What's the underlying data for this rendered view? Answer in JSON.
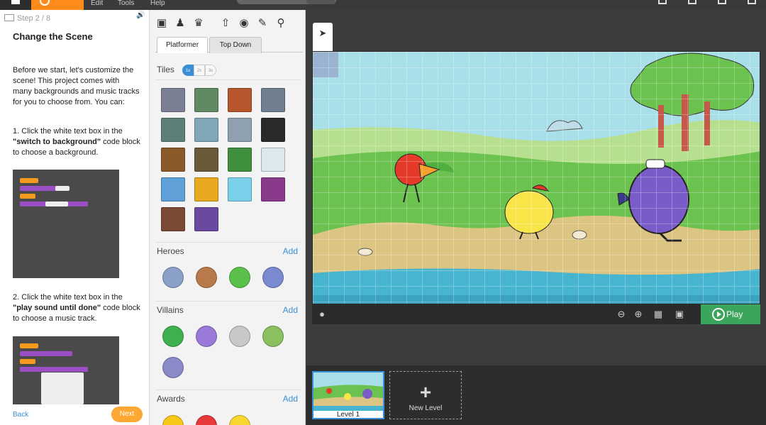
{
  "menu": {
    "edit": "Edit",
    "tools": "Tools",
    "help": "Help"
  },
  "instructions": {
    "step": "Step 2 / 8",
    "title": "Change the Scene",
    "intro": "Before we start, let's customize the scene! This project comes with many backgrounds and music tracks for you to choose from. You can:",
    "step1_pre": "1. Click the white text box in the ",
    "step1_bold": "\"switch to background\"",
    "step1_post": " code block to choose a background.",
    "step2_pre": "2. Click the white text box in the ",
    "step2_bold": "\"play sound until done\"",
    "step2_post": " code block to choose a music track.",
    "back": "Back",
    "next": "Next"
  },
  "assets": {
    "tabs": [
      "Platformer",
      "Top Down"
    ],
    "tiles_label": "Tiles",
    "size_options": [
      "1x",
      "2x",
      "3x"
    ],
    "heroes_label": "Heroes",
    "villains_label": "Villains",
    "awards_label": "Awards",
    "add": "Add",
    "tile_colors": [
      "#7b7f93",
      "#5f8a64",
      "#b7562c",
      "#6f7f8f",
      "#5d7f7a",
      "#7fa7b7",
      "#8fa0b0",
      "#2a2a2a",
      "#8a5a2a",
      "#6a5a3a",
      "#3f8f3f",
      "#dde8ef",
      "#5fa0d8",
      "#e8a820",
      "#7ad0e8",
      "#8a3a8a",
      "#7a4a34",
      "#6a4aa0"
    ],
    "hero_colors": [
      "#8aa0c8",
      "#b87a4a",
      "#5ac04a",
      "#7a8ad0"
    ],
    "villain_colors": [
      "#3fb04f",
      "#9a7ad8",
      "#c8c8c8",
      "#8ac060",
      "#8a8ac8"
    ],
    "award_colors": [
      "#f8c818",
      "#e83a3a",
      "#f8d830"
    ]
  },
  "stage": {
    "play": "Play",
    "colors": {
      "sky": "#a8dfe8",
      "ground": "#dcc483",
      "grass": "#6cc24f",
      "water": "#48b5d0",
      "play": "#3ba55c",
      "accent": "#3b8fd6"
    }
  },
  "levels": {
    "level1": "Level 1",
    "new_level": "New Level"
  }
}
